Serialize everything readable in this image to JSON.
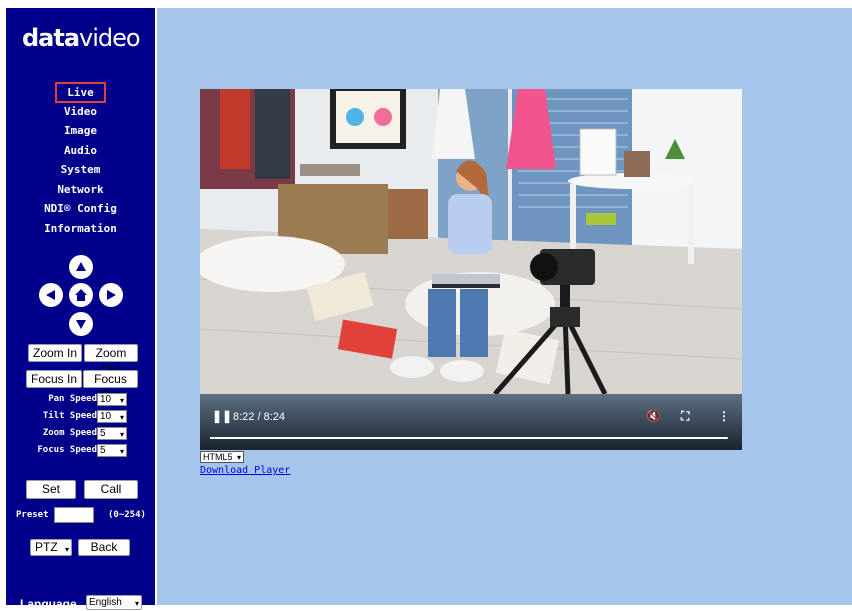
{
  "brand": {
    "logo_bold": "data",
    "logo_thin": "video"
  },
  "menu": {
    "items": [
      {
        "label": "Live",
        "active": true
      },
      {
        "label": "Video"
      },
      {
        "label": "Image"
      },
      {
        "label": "Audio"
      },
      {
        "label": "System"
      },
      {
        "label": "Network"
      },
      {
        "label": "NDI® Config"
      },
      {
        "label": "Information"
      }
    ]
  },
  "ptz": {
    "zoom_in": "Zoom In",
    "zoom_out": "Zoom Out",
    "focus_in": "Focus In",
    "focus_out": "Focus Out",
    "speeds": [
      {
        "label": "Pan Speed",
        "value": "10"
      },
      {
        "label": "Tilt Speed",
        "value": "10"
      },
      {
        "label": "Zoom Speed",
        "value": "5"
      },
      {
        "label": "Focus Speed",
        "value": "5"
      }
    ],
    "set_label": "Set",
    "call_label": "Call",
    "preset_label": "Preset",
    "preset_value": "",
    "preset_range": "(0~254)",
    "mode_select": "PTZ",
    "back_label": "Back"
  },
  "language": {
    "label": "Language",
    "value": "English"
  },
  "player": {
    "time": "8:22 / 8:24",
    "progress": 0.996,
    "format_select": "HTML5",
    "download_link": "Download Player"
  },
  "colors": {
    "sidebar": "#00008b",
    "main_bg": "#a5c5ea",
    "active_border": "#e0403a"
  }
}
